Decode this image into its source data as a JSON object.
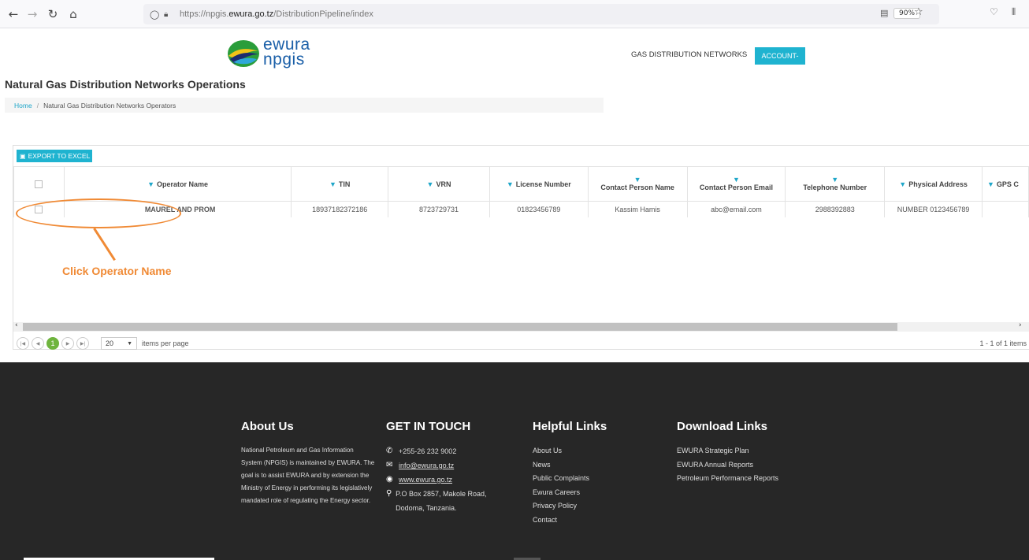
{
  "browser": {
    "url_prefix": "https://npgis.",
    "url_domain": "ewura.go.tz",
    "url_path": "/DistributionPipeline/index",
    "zoom": "90%"
  },
  "header": {
    "logo_line1": "ewura",
    "logo_line2": "npgis",
    "nav_link": "GAS DISTRIBUTION NETWORKS",
    "account_label": "ACCOUNT-"
  },
  "page": {
    "title": "Natural Gas Distribution Networks Operations",
    "breadcrumb_home": "Home",
    "breadcrumb_sep": "/",
    "breadcrumb_current": "Natural Gas Distribution Networks Operators"
  },
  "grid": {
    "export_label": "EXPORT TO EXCEL",
    "columns": [
      "Operator Name",
      "TIN",
      "VRN",
      "License Number",
      "Contact Person Name",
      "Contact Person Email",
      "Telephone Number",
      "Physical Address",
      "GPS C"
    ],
    "rows": [
      {
        "operator_name": "MAUREL AND PROM",
        "tin": "18937182372186",
        "vrn": "8723729731",
        "license_number": "01823456789",
        "contact_person": "Kassim Hamis",
        "email": "abc@email.com",
        "telephone": "2988392883",
        "address": "NUMBER 0123456789",
        "gps": ""
      }
    ],
    "pager": {
      "current_page": "1",
      "page_size": "20",
      "items_per_page_label": "items per page",
      "info": "1 - 1 of 1 items"
    }
  },
  "annotation": {
    "text": "Click Operator Name",
    "color": "#f08a35"
  },
  "footer": {
    "about_title": "About Us",
    "about_text": "National Petroleum and Gas Information System (NPGIS) is maintained by EWURA. The goal is to assist EWURA and by extension the Ministry of Energy in performing its legislatively mandated role of regulating the Energy sector.",
    "contact_title": "GET IN TOUCH",
    "phone": "+255-26 232 9002",
    "email": "info@ewura.go.tz",
    "website": "www.ewura.go.tz",
    "address": "P.O Box 2857, Makole Road, Dodoma, Tanzania.",
    "helpful_title": "Helpful Links",
    "helpful_links": [
      "About Us",
      "News",
      "Public Complaints",
      "Ewura Careers",
      "Privacy Policy",
      "Contact"
    ],
    "download_title": "Download Links",
    "download_links": [
      "EWURA Strategic Plan",
      "EWURA Annual Reports",
      "Petroleum Performance Reports"
    ]
  },
  "colors": {
    "accent": "#1fb3d0",
    "link": "#1f7fbf",
    "pager_active": "#6fb43e",
    "footer_bg": "#272727"
  }
}
